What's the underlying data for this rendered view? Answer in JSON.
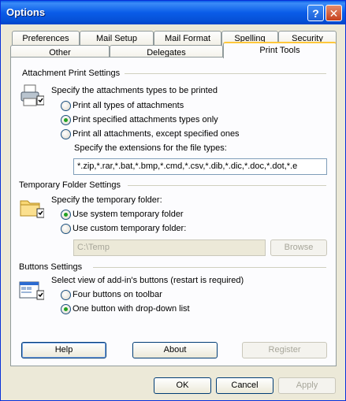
{
  "window": {
    "title": "Options",
    "help_glyph": "?",
    "close_glyph": "✕"
  },
  "tabs": {
    "row1": [
      "Preferences",
      "Mail Setup",
      "Mail Format",
      "Spelling",
      "Security"
    ],
    "row2": [
      "Other",
      "Delegates",
      "Print Tools"
    ],
    "active": "Print Tools"
  },
  "attachment_print": {
    "title": "Attachment Print Settings",
    "prompt": "Specify the attachments types to be printed",
    "options": [
      "Print all types of attachments",
      "Print specified attachments types only",
      "Print all attachments, except specified ones"
    ],
    "selected_index": 1,
    "extensions_label": "Specify the extensions for the file types:",
    "extensions_value": "*.zip,*.rar,*.bat,*.bmp,*.cmd,*.csv,*.dib,*.dic,*.doc,*.dot,*.e"
  },
  "temp_folder": {
    "title": "Temporary Folder Settings",
    "prompt": "Specify the temporary folder:",
    "options": [
      "Use system temporary folder",
      "Use custom temporary folder:"
    ],
    "selected_index": 0,
    "path_value": "C:\\Temp",
    "browse_label": "Browse"
  },
  "buttons_settings": {
    "title": "Buttons Settings",
    "prompt": "Select view of add-in's buttons (restart is required)",
    "options": [
      "Four buttons on toolbar",
      "One button with drop-down list"
    ],
    "selected_index": 1
  },
  "panel_buttons": {
    "help": "Help",
    "about": "About",
    "register": "Register"
  },
  "dialog_buttons": {
    "ok": "OK",
    "cancel": "Cancel",
    "apply": "Apply"
  }
}
